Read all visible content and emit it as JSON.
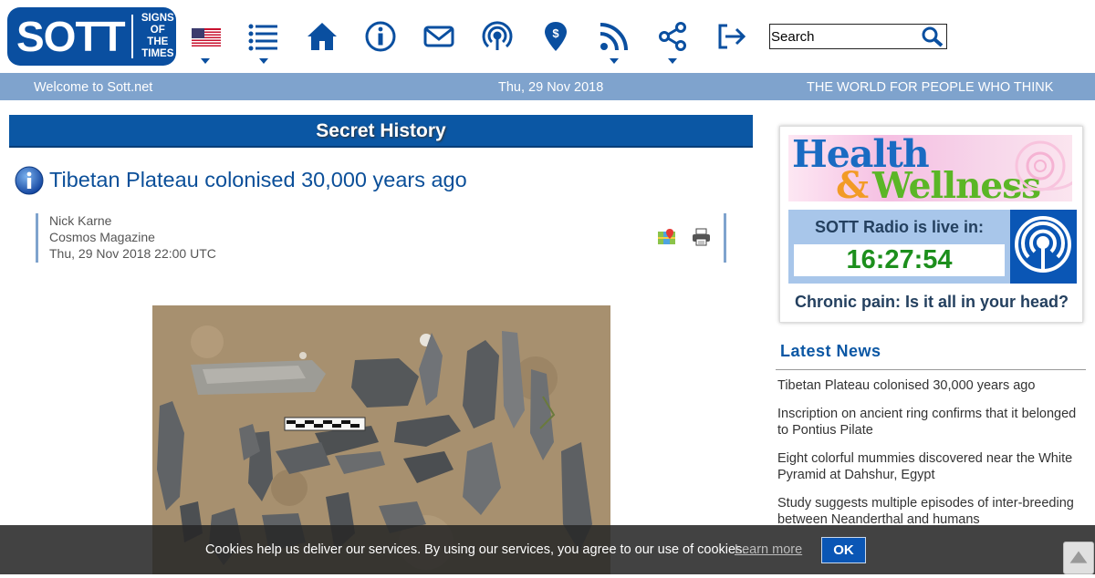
{
  "header": {
    "logo": {
      "main": "SOTT",
      "sub_line1": "SIGNS",
      "sub_line2": "OF THE",
      "sub_line3": "TIMES"
    },
    "nav_icons": [
      "us-flag-icon",
      "list-icon",
      "home-icon",
      "info-icon",
      "mail-icon",
      "podcast-icon",
      "donate-icon",
      "rss-icon",
      "share-icon",
      "login-icon"
    ],
    "search": {
      "placeholder": "Search"
    }
  },
  "strip": {
    "welcome": "Welcome to Sott.net",
    "date": "Thu, 29 Nov 2018",
    "tagline": "THE WORLD FOR PEOPLE WHO THINK"
  },
  "article": {
    "section": "Secret History",
    "title": "Tibetan Plateau colonised 30,000 years ago",
    "author": "Nick Karne",
    "source": "Cosmos Magazine",
    "timestamp": "Thu, 29 Nov 2018 22:00 UTC"
  },
  "sidebar": {
    "banner": {
      "word1": "Health",
      "amp": "&",
      "word2": "Wellness"
    },
    "radio_label": "SOTT Radio is live in:",
    "radio_time": "16:27:54",
    "radio_show": "Chronic pain: Is it all in your head?",
    "latest_title": "Latest News",
    "latest": [
      "Tibetan Plateau colonised 30,000 years ago",
      "Inscription on ancient ring confirms that it belonged to Pontius Pilate",
      "Eight colorful mummies discovered near the White Pyramid at Dahshur, Egypt",
      "Study suggests multiple episodes of inter-breeding between Neanderthal and humans"
    ]
  },
  "cookie": {
    "text": "Cookies help us deliver our services. By using our services, you agree to our use of cookies.",
    "learn_more": "Learn more",
    "ok": "OK"
  },
  "colors": {
    "brand": "#0a4fa0",
    "strip": "#7fa3cd",
    "section": "#0b57a4",
    "clock": "#1d8f1d"
  }
}
